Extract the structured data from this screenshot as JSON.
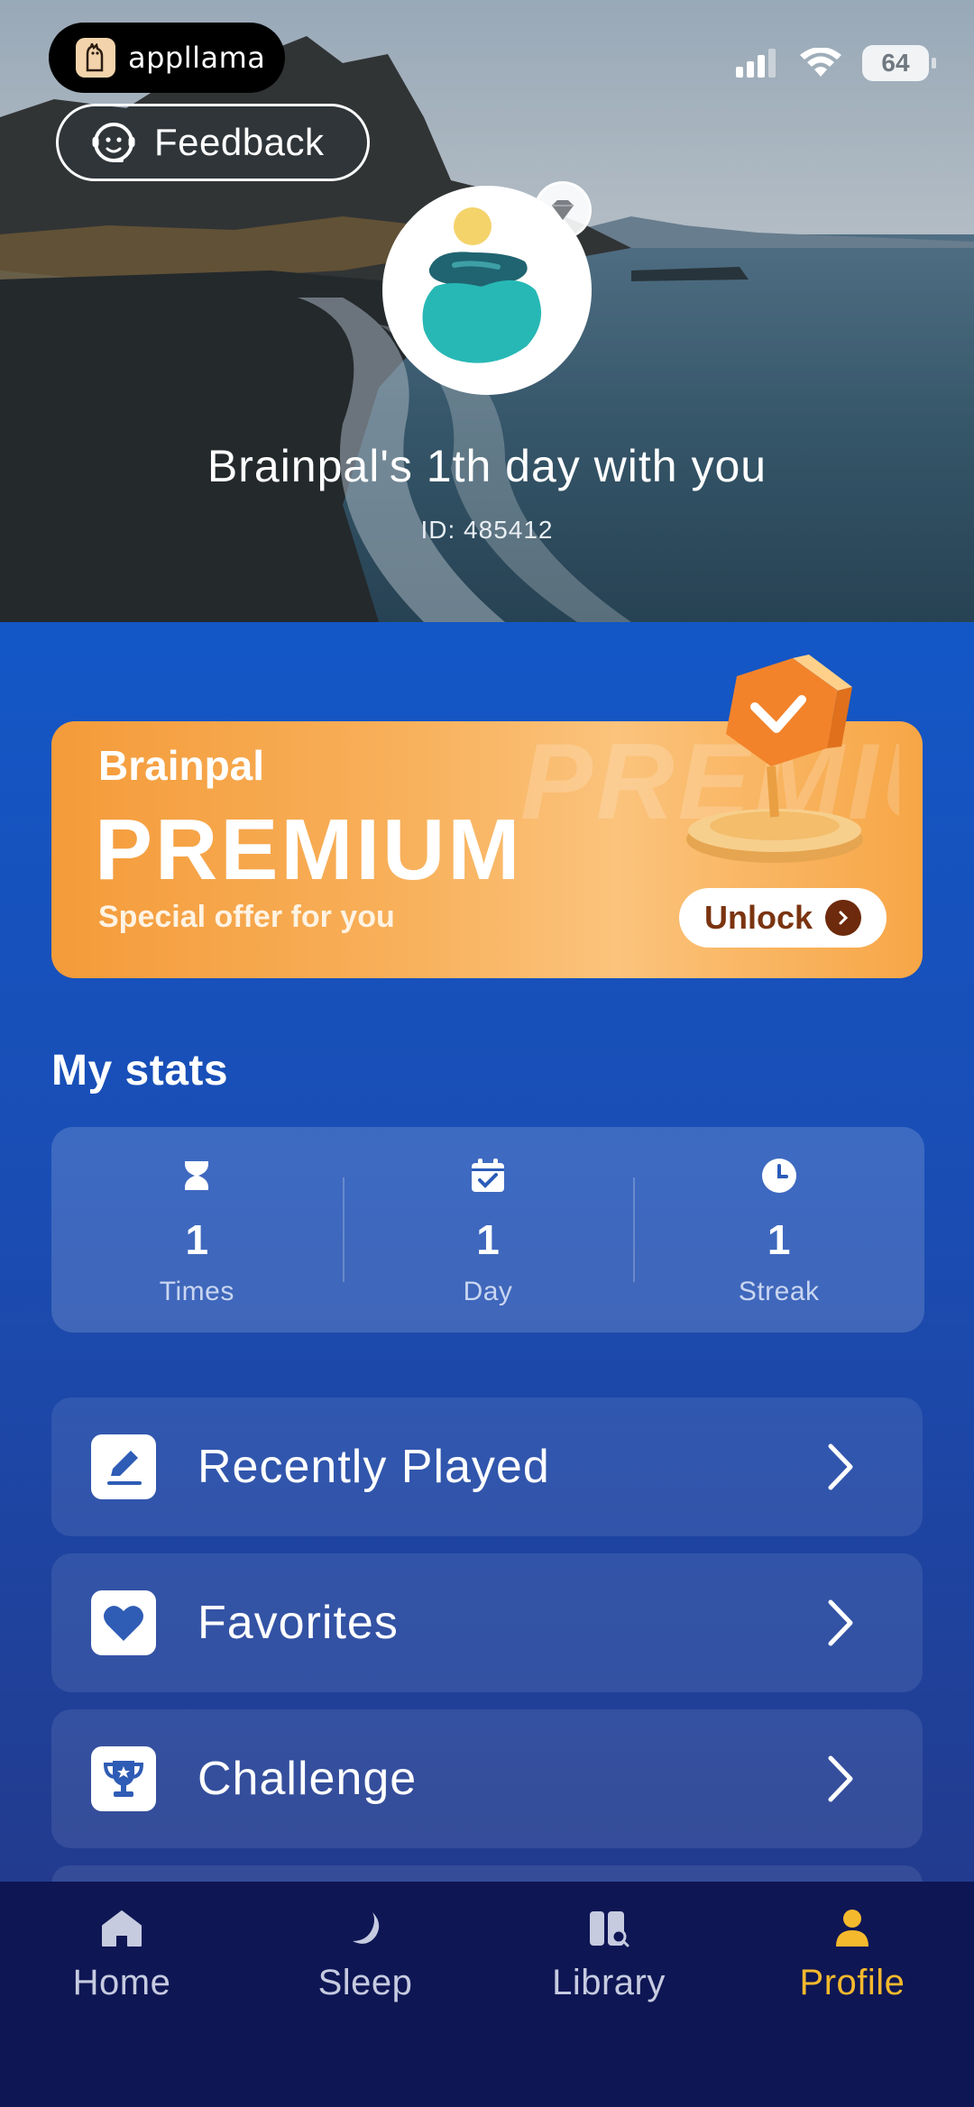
{
  "status_bar": {
    "battery": "64"
  },
  "recording_badge": {
    "text": "appllama"
  },
  "header": {
    "feedback_label": "Feedback",
    "title": "Brainpal's 1th day with you",
    "user_id": "ID: 485412"
  },
  "premium": {
    "brand": "Brainpal",
    "title": "PREMIUM",
    "subtitle": "Special offer for you",
    "unlock_label": "Unlock",
    "watermark": "PREMIUM"
  },
  "stats": {
    "title": "My stats",
    "items": [
      {
        "icon": "hourglass-icon",
        "value": "1",
        "label": "Times"
      },
      {
        "icon": "calendar-check-icon",
        "value": "1",
        "label": "Day"
      },
      {
        "icon": "clock-icon",
        "value": "1",
        "label": "Streak"
      }
    ]
  },
  "menu": [
    {
      "icon": "pencil-icon",
      "label": "Recently Played"
    },
    {
      "icon": "heart-icon",
      "label": "Favorites"
    },
    {
      "icon": "trophy-icon",
      "label": "Challenge"
    }
  ],
  "tabs": [
    {
      "icon": "home-icon",
      "label": "Home",
      "active": false
    },
    {
      "icon": "moon-icon",
      "label": "Sleep",
      "active": false
    },
    {
      "icon": "library-icon",
      "label": "Library",
      "active": false
    },
    {
      "icon": "profile-icon",
      "label": "Profile",
      "active": true
    }
  ],
  "colors": {
    "accent": "#f5b92d",
    "main_blue": "#1357c6",
    "tabbar": "#0e1654",
    "premium_orange": "#f49b3a"
  }
}
